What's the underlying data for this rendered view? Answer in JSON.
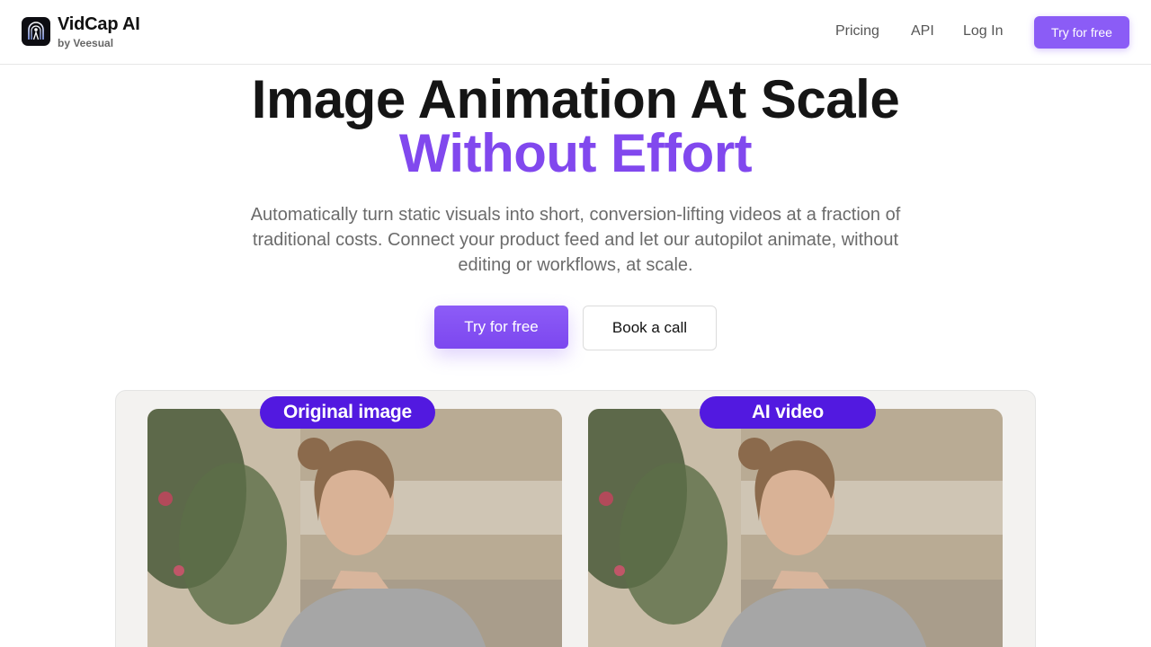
{
  "brand": {
    "name": "VidCap AI",
    "byline": "by Veesual",
    "logo_icon": "vidcap-logo-icon"
  },
  "nav": {
    "items": [
      "Pricing",
      "API",
      "Log In"
    ],
    "cta": "Try for free"
  },
  "hero": {
    "title": "Image Animation At Scale",
    "title_accent": "Without Effort",
    "subtitle": "Automatically turn static visuals into short, conversion-lifting videos at a fraction of traditional costs. Connect your product feed and let our autopilot animate, without editing or workflows, at scale.",
    "primary_cta": "Try for free",
    "secondary_cta": "Book a call"
  },
  "demo": {
    "original_label": "Original image",
    "video_label": "AI video"
  },
  "colors": {
    "accent": "#8148ee",
    "button": "#8b5cf6",
    "pill": "#5219e0"
  }
}
